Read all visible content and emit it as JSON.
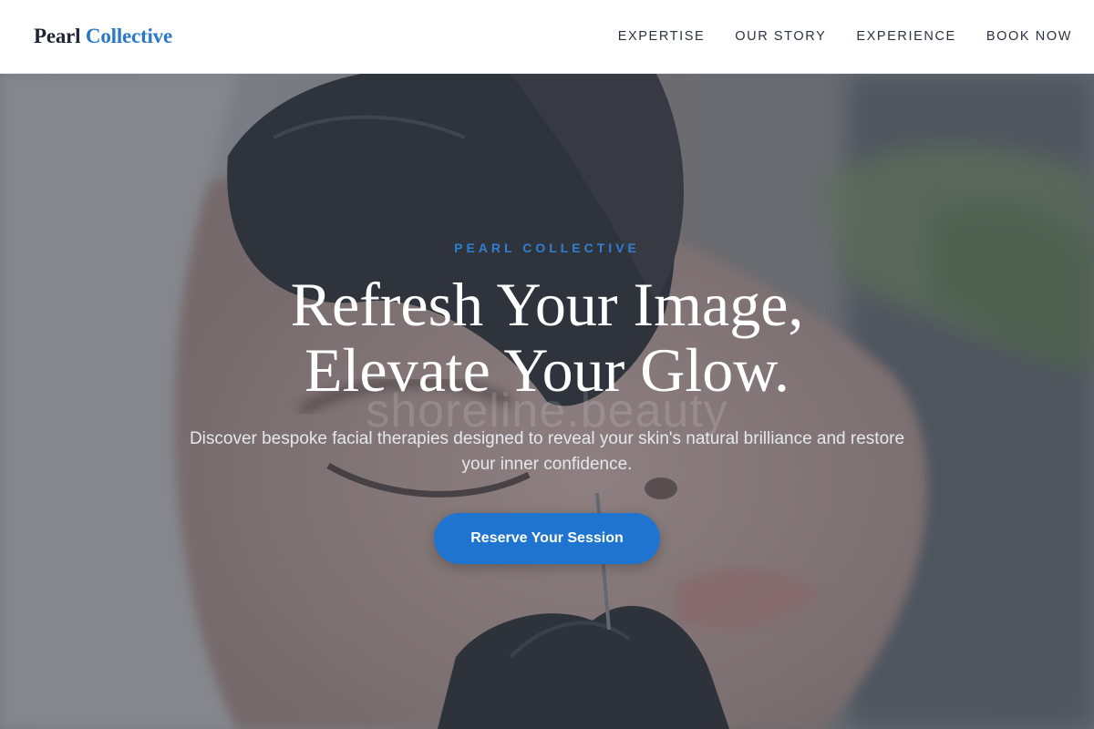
{
  "brand": {
    "name_part1": "Pearl",
    "name_part2": "Collective",
    "primary_color": "#1f2633",
    "accent_color": "#2a78c8"
  },
  "nav": {
    "items": [
      {
        "label": "EXPERTISE"
      },
      {
        "label": "OUR STORY"
      },
      {
        "label": "EXPERIENCE"
      },
      {
        "label": "BOOK NOW"
      }
    ]
  },
  "hero": {
    "eyebrow": "PEARL COLLECTIVE",
    "headline_line1": "Refresh Your Image,",
    "headline_line2": "Elevate Your Glow.",
    "watermark": "shoreline.beauty",
    "subtext": "Discover bespoke facial therapies designed to reveal your skin's natural brilliance and restore your inner confidence.",
    "cta_label": "Reserve Your Session",
    "cta_color": "#1f74d0",
    "background_image": "facial-treatment-photo"
  }
}
